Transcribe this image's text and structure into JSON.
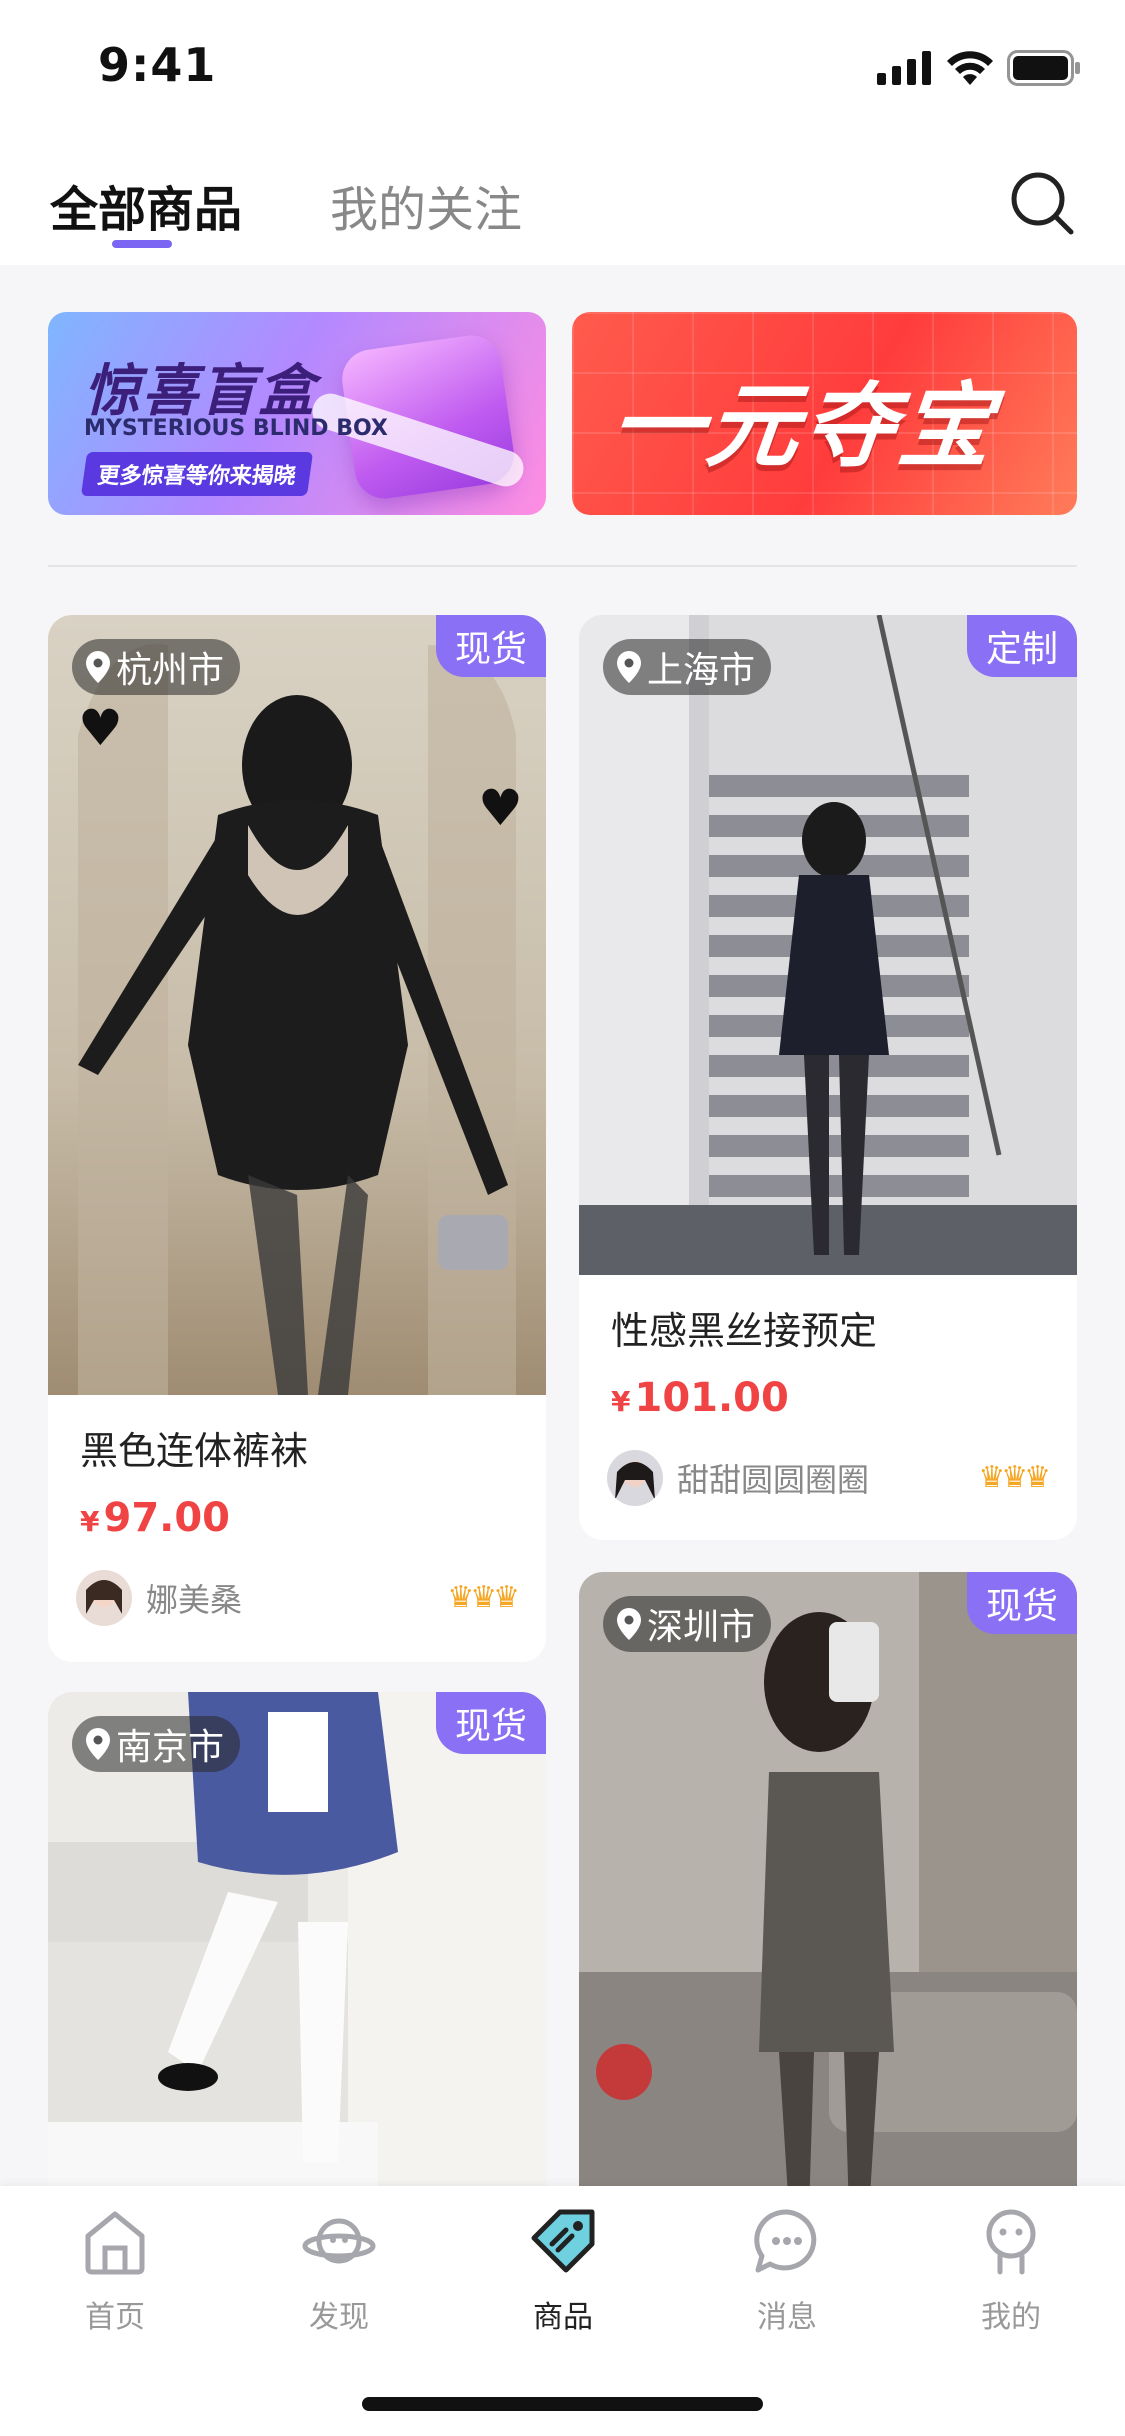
{
  "status_bar": {
    "time": "9:41"
  },
  "header": {
    "tabs": [
      {
        "label": "全部商品",
        "active": true
      },
      {
        "label": "我的关注",
        "active": false
      }
    ],
    "accent_color": "#7a66f2"
  },
  "banners": {
    "blind_box": {
      "title": "惊喜盲盒",
      "subtitle_en": "MYSTERIOUS BLIND BOX",
      "tagline": "更多惊喜等你来揭晓"
    },
    "duobao": {
      "title": "一元夺宝"
    }
  },
  "products": [
    {
      "location": "杭州市",
      "type": "现货",
      "title": "黑色连体裤袜",
      "currency": "¥",
      "price": "97.00",
      "seller": "娜美桑",
      "crowns": "♛♛♛"
    },
    {
      "location": "上海市",
      "type": "定制",
      "title": "性感黑丝接预定",
      "currency": "¥",
      "price": "101.00",
      "seller": "甜甜圆圆圈圈",
      "crowns": "♛♛♛"
    },
    {
      "location": "南京市",
      "type": "现货"
    },
    {
      "location": "深圳市",
      "type": "现货"
    }
  ],
  "price_color": "#f04444",
  "tabbar": {
    "items": [
      {
        "label": "首页",
        "icon": "home-icon"
      },
      {
        "label": "发现",
        "icon": "planet-icon"
      },
      {
        "label": "商品",
        "icon": "tag-icon",
        "active": true
      },
      {
        "label": "消息",
        "icon": "chat-bubble-icon"
      },
      {
        "label": "我的",
        "icon": "person-icon"
      }
    ]
  }
}
